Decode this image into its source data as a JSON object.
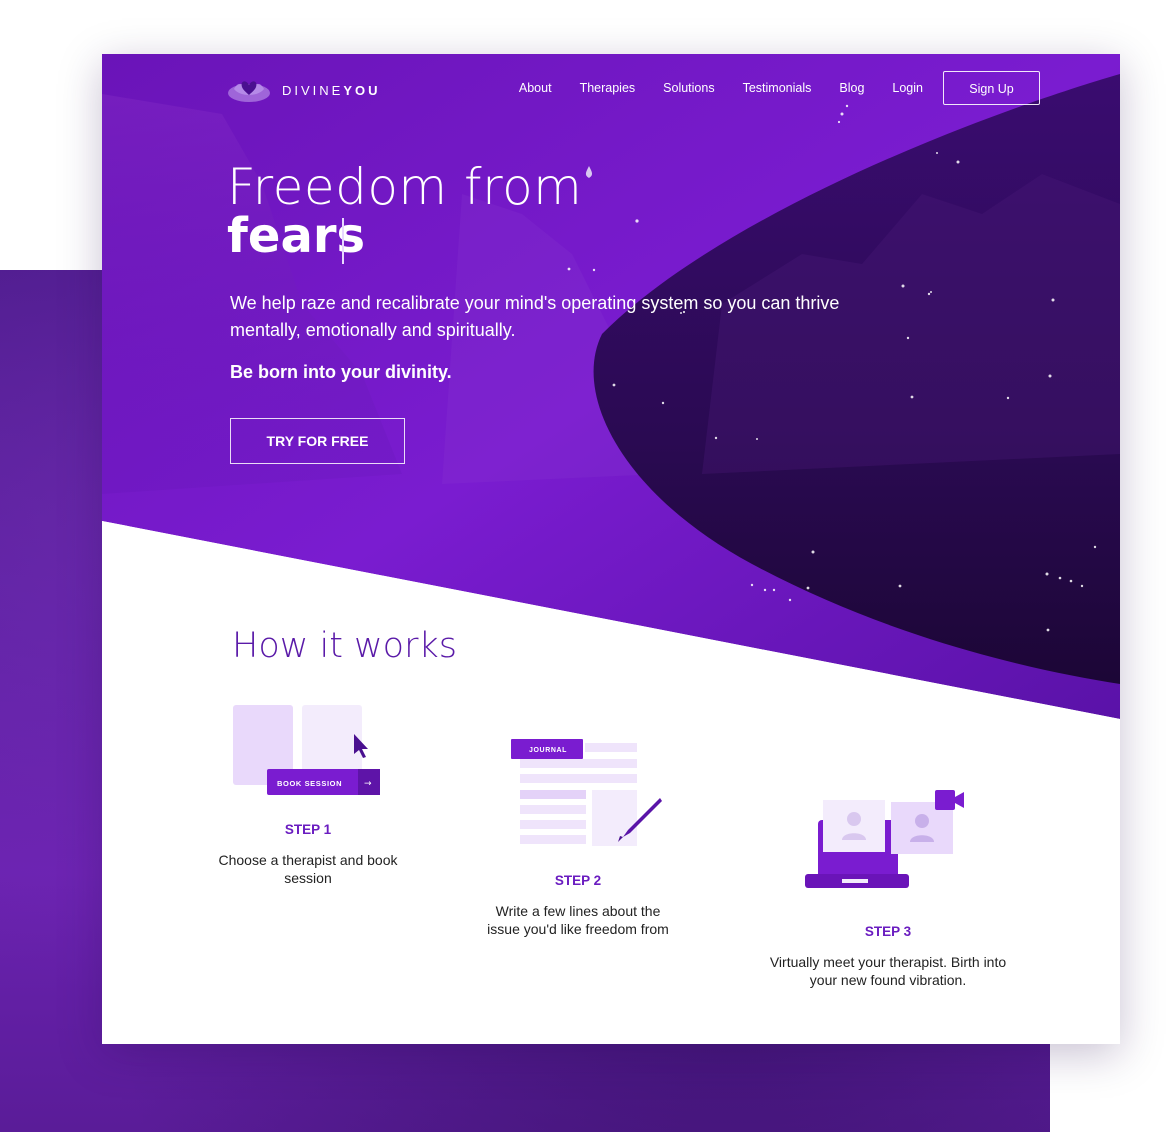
{
  "brand": {
    "name_light": "DIVINE",
    "name_bold": "YOU"
  },
  "nav": {
    "links": [
      "About",
      "Therapies",
      "Solutions",
      "Testimonials",
      "Blog",
      "Login"
    ],
    "signup_label": "Sign Up"
  },
  "hero": {
    "title_line1": "Freedom from",
    "title_line2": "fears",
    "lead": "We help raze and recalibrate your mind's operating system so you can thrive mentally, emotionally and spiritually.",
    "tagline": "Be born into your divinity.",
    "cta_label": "TRY FOR FREE"
  },
  "how": {
    "title": "How it works",
    "steps": [
      {
        "label": "STEP 1",
        "text": "Choose a therapist and book session",
        "illus_button": "BOOK SESSION",
        "illus_arrow": "→"
      },
      {
        "label": "STEP 2",
        "text": "Write a few lines about the issue you'd like freedom from",
        "illus_tag": "JOURNAL"
      },
      {
        "label": "STEP 3",
        "text": "Virtually meet your therapist. Birth into your new found vibration."
      }
    ]
  },
  "colors": {
    "brand_purple": "#6a1cc0",
    "deep_purple": "#2a0a4a",
    "hero_purple": "#7a1ed0"
  }
}
